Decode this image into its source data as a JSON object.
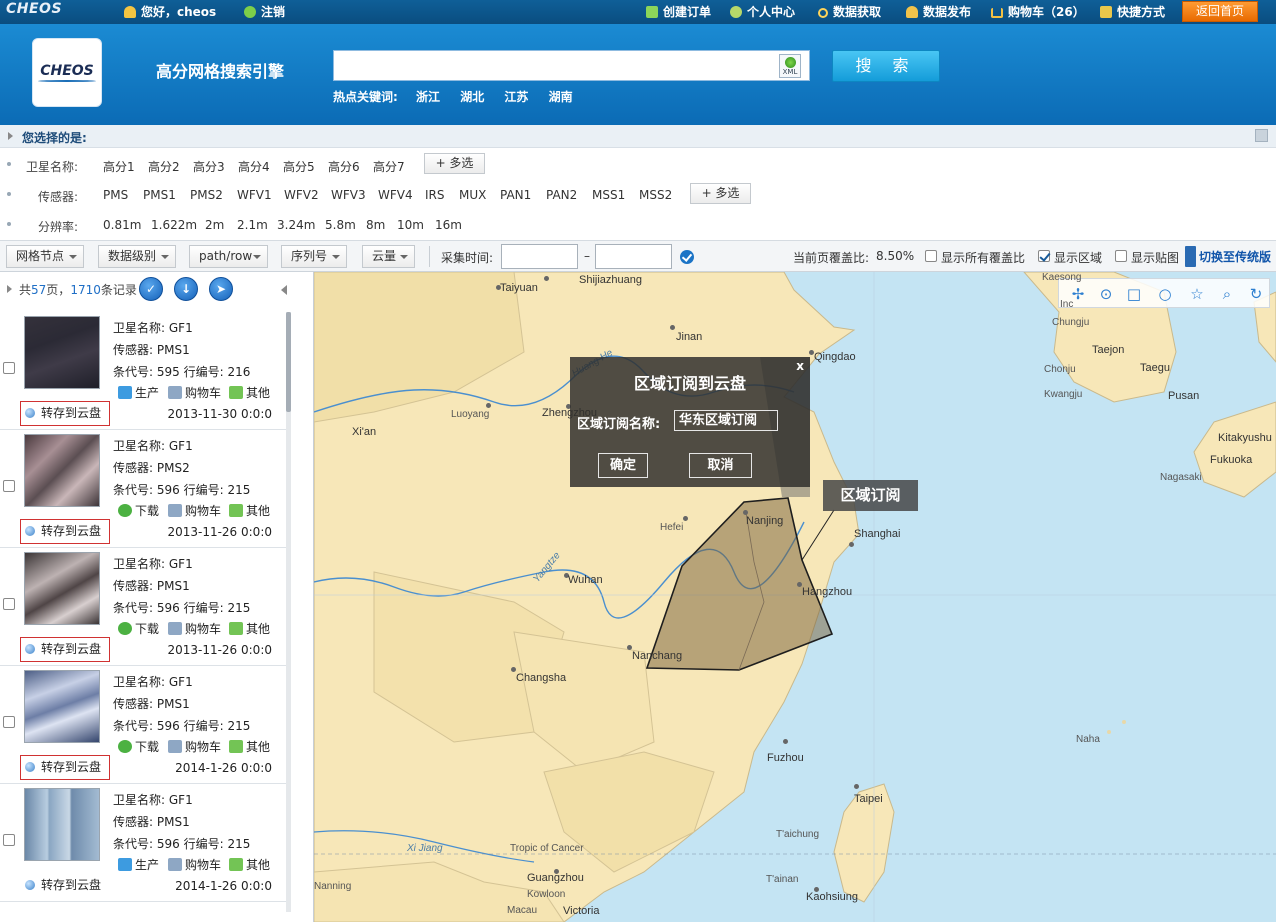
{
  "topbar": {
    "logo": "CHEOS",
    "greeting": "您好，cheos",
    "logout": "注销",
    "nav": [
      {
        "label": "创建订单",
        "icon": "plus-icon"
      },
      {
        "label": "个人中心",
        "icon": "users-icon"
      },
      {
        "label": "数据获取",
        "icon": "search-icon"
      },
      {
        "label": "数据发布",
        "icon": "person-upload-icon"
      },
      {
        "label": "购物车（26）",
        "icon": "cart-icon"
      },
      {
        "label": "快捷方式",
        "icon": "shortcut-icon"
      }
    ],
    "home_button": "返回首页"
  },
  "header": {
    "logo": "CHEOS",
    "title": "高分网格搜索引擎",
    "search_value": "",
    "xml_label": "XML",
    "search_button": "搜 索",
    "hot_label": "热点关键词:",
    "hot_keywords": [
      "浙江",
      "湖北",
      "江苏",
      "湖南"
    ]
  },
  "selection": {
    "title": "您选择的是:",
    "satellite_label": "卫星名称:",
    "satellites": [
      "高分1",
      "高分2",
      "高分3",
      "高分4",
      "高分5",
      "高分6",
      "高分7"
    ],
    "sensor_label": "传感器:",
    "sensors": [
      "PMS",
      "PMS1",
      "PMS2",
      "WFV1",
      "WFV2",
      "WFV3",
      "WFV4",
      "IRS",
      "MUX",
      "PAN1",
      "PAN2",
      "MSS1",
      "MSS2"
    ],
    "resolution_label": "分辨率:",
    "resolutions": [
      "0.81m",
      "1.622m",
      "2m",
      "2.1m",
      "3.24m",
      "5.8m",
      "8m",
      "10m",
      "16m"
    ],
    "multi_select": "+ 多选"
  },
  "toolbar": {
    "dropdowns": [
      "网格节点",
      "数据级别",
      "path/row",
      "序列号",
      "云量"
    ],
    "time_label": "采集时间:",
    "date_from": "",
    "date_to": "",
    "dash": "–",
    "coverage_label": "当前页覆盖比:",
    "coverage_value": "8.50%",
    "show_all_coverage": "显示所有覆盖比",
    "show_region": "显示区域",
    "show_tiles": "显示贴图",
    "switch_label": "切换至传统版"
  },
  "list": {
    "summary_prefix": "共",
    "pages": "57",
    "summary_mid": "页，",
    "records": "1710",
    "summary_suffix": "条记录",
    "field_labels": {
      "satellite": "卫星名称:",
      "sensor": "传感器:",
      "strip": "条代号:",
      "row": "行编号:"
    },
    "save_label": "转存到云盘",
    "items": [
      {
        "satellite": "GF1",
        "sensor": "PMS1",
        "strip": "595",
        "row": "216",
        "action1": "生产",
        "action2": "购物车",
        "action3": "其他",
        "date": "2013-11-30 0:0:0",
        "save_highlight": true
      },
      {
        "satellite": "GF1",
        "sensor": "PMS2",
        "strip": "596",
        "row": "215",
        "action1": "下载",
        "action2": "购物车",
        "action3": "其他",
        "date": "2013-11-26 0:0:0",
        "save_highlight": true
      },
      {
        "satellite": "GF1",
        "sensor": "PMS1",
        "strip": "596",
        "row": "215",
        "action1": "下载",
        "action2": "购物车",
        "action3": "其他",
        "date": "2013-11-26 0:0:0",
        "save_highlight": true
      },
      {
        "satellite": "GF1",
        "sensor": "PMS1",
        "strip": "596",
        "row": "215",
        "action1": "下载",
        "action2": "购物车",
        "action3": "其他",
        "date": "2014-1-26 0:0:0",
        "save_highlight": true
      },
      {
        "satellite": "GF1",
        "sensor": "PMS1",
        "strip": "596",
        "row": "215",
        "action1": "生产",
        "action2": "购物车",
        "action3": "其他",
        "date": "2014-1-26 0:0:0",
        "save_highlight": false
      }
    ]
  },
  "map": {
    "labels": [
      "Taiyuan",
      "Shijiazhuang",
      "Jinan",
      "Qingdao",
      "Luoyang",
      "Zhengzhou",
      "Xi'an",
      "Hefei",
      "Nanjing",
      "Shanghai",
      "Wuhan",
      "Hangzhou",
      "Nanchang",
      "Changsha",
      "Fuzhou",
      "Taipei",
      "T'aichung",
      "T'ainan",
      "Kaohsiung",
      "Guangzhou",
      "Kowloon",
      "Victoria",
      "Macau",
      "Nanning",
      "Chungju",
      "Taejon",
      "Chonju",
      "Taegu",
      "Kwangju",
      "Pusan",
      "Kitakyushu",
      "Fukuoka",
      "Nagasaki",
      "Kaesong",
      "Inc",
      "Naha",
      "Huang He",
      "Yangtze",
      "Xi Jiang",
      "Tropic of Cancer"
    ],
    "region_callout": "区域订阅"
  },
  "dialog": {
    "title": "区域订阅到云盘",
    "close": "x",
    "name_label": "区域订阅名称:",
    "name_value": "华东区域订阅",
    "confirm": "确定",
    "cancel": "取消"
  }
}
